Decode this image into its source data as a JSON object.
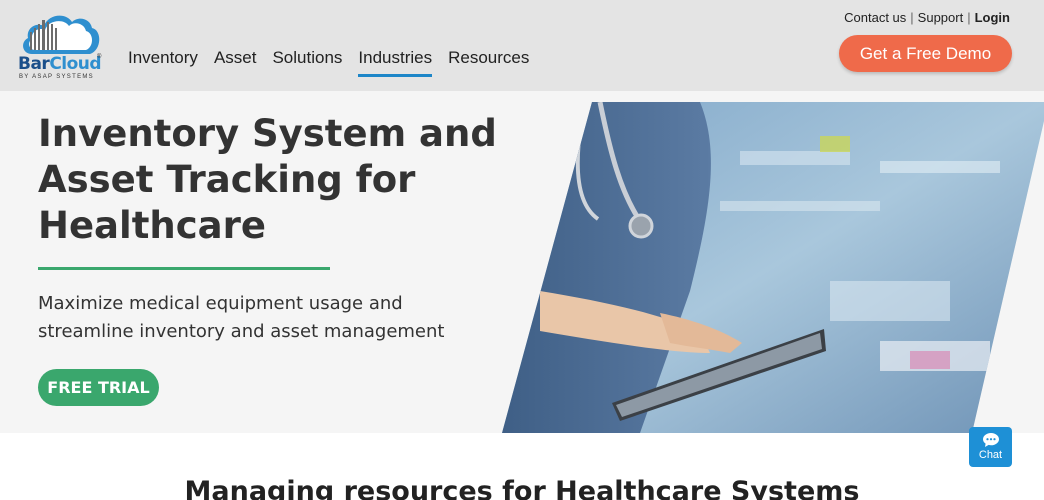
{
  "logo": {
    "bar": "Bar",
    "cloud": "Cloud",
    "tagline": "BY ASAP SYSTEMS",
    "reg": "®"
  },
  "nav": {
    "items": [
      {
        "label": "Inventory",
        "active": false
      },
      {
        "label": "Asset",
        "active": false
      },
      {
        "label": "Solutions",
        "active": false
      },
      {
        "label": "Industries",
        "active": true
      },
      {
        "label": "Resources",
        "active": false
      }
    ]
  },
  "toplinks": {
    "contact": "Contact us",
    "support": "Support",
    "login": "Login",
    "separator": "|"
  },
  "header": {
    "demo_label": "Get a Free Demo"
  },
  "hero": {
    "title": "Inventory System and Asset Tracking for Healthcare",
    "subtitle": "Maximize medical equipment usage and streamline inventory and asset management",
    "trial_label": "FREE TRIAL"
  },
  "section": {
    "title": "Managing resources for Healthcare Systems"
  },
  "chat": {
    "label": "Chat"
  },
  "colors": {
    "header_bg": "#e4e4e4",
    "accent_orange": "#ef6a4a",
    "accent_green": "#3aa76d",
    "accent_blue": "#1d86c8",
    "logo_navy": "#1b4f8a"
  }
}
